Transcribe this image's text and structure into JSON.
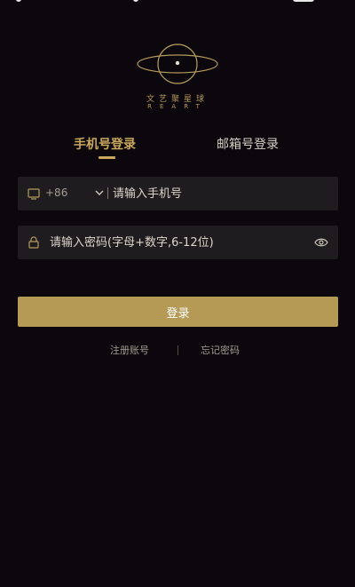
{
  "brand": {
    "name_cn": "文艺聚星球",
    "name_en": "REART",
    "accent_color": "#c9a75d"
  },
  "tabs": [
    {
      "label": "手机号登录",
      "active": true
    },
    {
      "label": "邮箱号登录",
      "active": false
    }
  ],
  "phone_field": {
    "icon": "phone-icon",
    "country_code": "+86",
    "placeholder": "请输入手机号",
    "value": ""
  },
  "password_field": {
    "icon": "lock-icon",
    "placeholder": "请输入密码(字母+数字,6-12位)",
    "value": "",
    "toggle_icon": "eye-icon"
  },
  "login_button": {
    "label": "登录",
    "color": "#b49a55"
  },
  "links": {
    "register": "注册账号",
    "forgot": "忘记密码"
  }
}
